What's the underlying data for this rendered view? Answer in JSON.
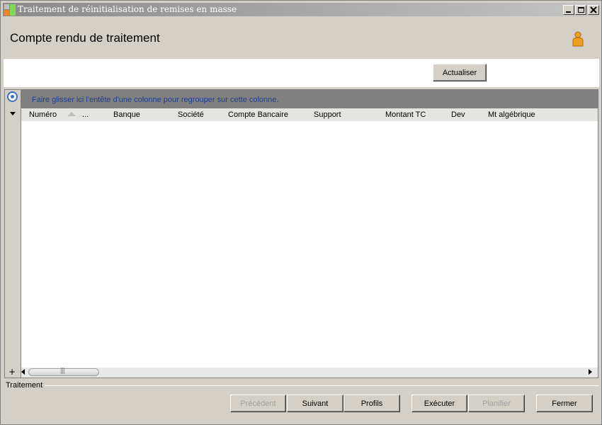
{
  "window": {
    "title": "Traitement de réinitialisation de remises en masse",
    "icons": {
      "app": "app-icon",
      "minimize": "minimize-icon",
      "maximize": "maximize-icon",
      "close": "close-icon"
    }
  },
  "header": {
    "title": "Compte rendu de traitement",
    "user_icon": "user-icon"
  },
  "toolbar": {
    "refresh_label": "Actualiser"
  },
  "grid": {
    "group_hint": "Faire glisser ici l'entête d'une colonne pour regrouper sur cette colonne.",
    "columns": [
      {
        "label": "Numéro"
      },
      {
        "label": "..."
      },
      {
        "label": "Banque"
      },
      {
        "label": "Société"
      },
      {
        "label": "Compte Bancaire"
      },
      {
        "label": "Support"
      },
      {
        "label": "Montant TC"
      },
      {
        "label": "Dev"
      },
      {
        "label": "Mt algébrique"
      }
    ],
    "rows": [],
    "expand_symbol": "+"
  },
  "footer": {
    "section_label": "Traitement",
    "buttons": {
      "previous": "Précédent",
      "next": "Suivant",
      "profiles": "Profils",
      "execute": "Exécuter",
      "schedule": "Planifier",
      "close": "Fermer"
    },
    "disabled": [
      "previous",
      "schedule"
    ]
  },
  "colors": {
    "title_bar_start": "#8a8a8a",
    "group_panel": "#808080",
    "group_hint_text": "#1f3e8c",
    "window_background": "#d4d0c8",
    "user_icon": "#f0a020"
  }
}
